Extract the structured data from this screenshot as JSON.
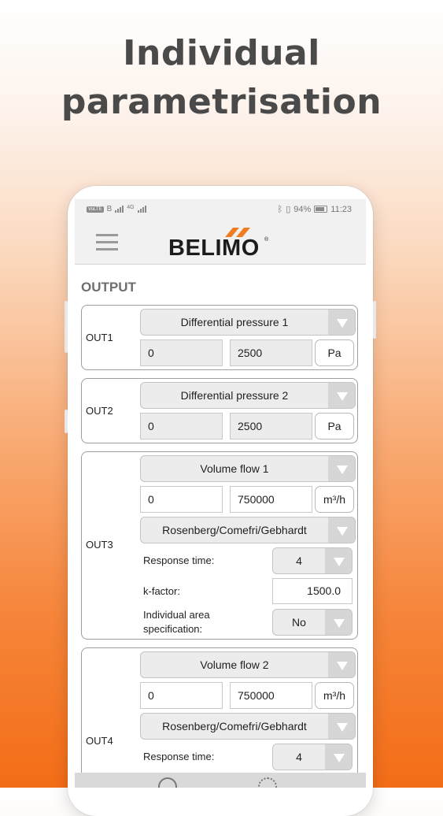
{
  "headline": {
    "line1": "Individual",
    "line2": "parametrisation"
  },
  "statusbar": {
    "volte": "VoLTE",
    "sim": "B",
    "network": "4G",
    "battery": "94%",
    "time": "11:23"
  },
  "app": {
    "brand": "BELIMO",
    "reg": "®",
    "brand_accent": "#f07c22"
  },
  "section_title": "OUTPUT",
  "out1": {
    "label": "OUT1",
    "signal": "Differential pressure 1",
    "min": "0",
    "max": "2500",
    "unit": "Pa"
  },
  "out2": {
    "label": "OUT2",
    "signal": "Differential pressure 2",
    "min": "0",
    "max": "2500",
    "unit": "Pa"
  },
  "out3": {
    "label": "OUT3",
    "signal": "Volume flow 1",
    "min": "0",
    "max": "750000",
    "unit": "m³/h",
    "fan": "Rosenberg/Comefri/Gebhardt",
    "response_label": "Response time:",
    "response_value": "4",
    "kfactor_label": "k-factor:",
    "kfactor_value": "1500.0",
    "area_label_1": "Individual area",
    "area_label_2": "specification:",
    "area_value": "No"
  },
  "out4": {
    "label": "OUT4",
    "signal": "Volume flow 2",
    "min": "0",
    "max": "750000",
    "unit": "m³/h",
    "fan": "Rosenberg/Comefri/Gebhardt",
    "response_label": "Response time:",
    "response_value": "4"
  },
  "colors": {
    "accent": "#f36d17",
    "card_border": "#9e9e9e",
    "dropdown_bg": "#ececec"
  }
}
